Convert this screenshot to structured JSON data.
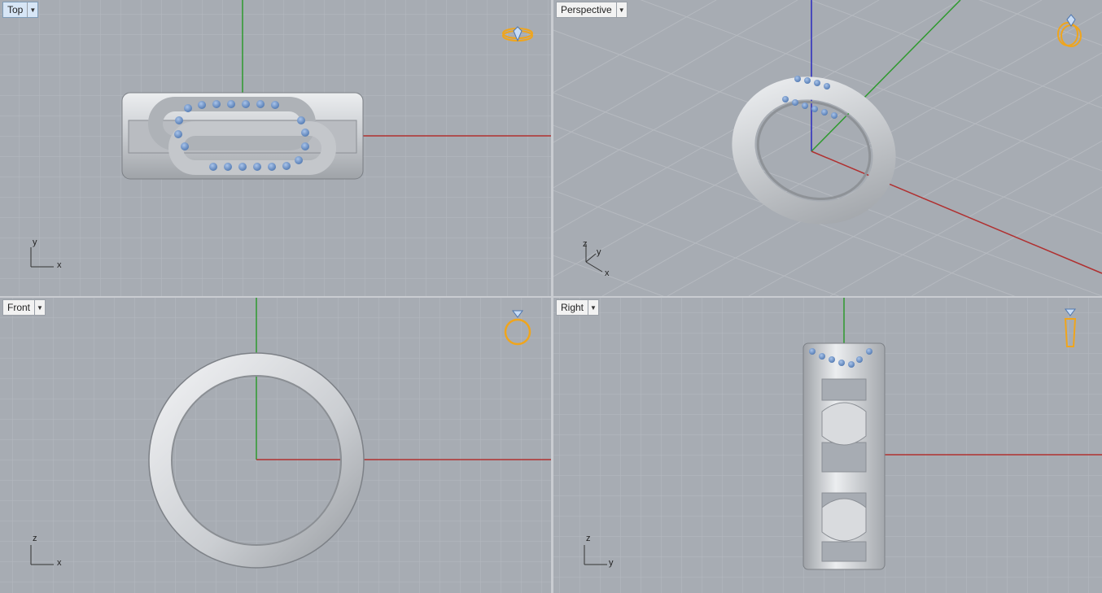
{
  "viewports": {
    "top": {
      "label": "Top",
      "active": true,
      "axis_h": "x",
      "axis_v": "y",
      "widget_icon": "ring-top-view-icon"
    },
    "perspective": {
      "label": "Perspective",
      "active": false,
      "axis_h": "x",
      "axis_v": "y",
      "axis_z": "z",
      "widget_icon": "ring-perspective-icon"
    },
    "front": {
      "label": "Front",
      "active": false,
      "axis_h": "x",
      "axis_v": "z",
      "widget_icon": "ring-front-view-icon"
    },
    "right": {
      "label": "Right",
      "active": false,
      "axis_h": "y",
      "axis_v": "z",
      "widget_icon": "ring-side-view-icon"
    }
  },
  "colors": {
    "viewport_bg": "#a7acb3",
    "grid_minor": "#b4b8be",
    "grid_major": "#8e939a",
    "axis_x": "#b03030",
    "axis_y": "#2e9a2e",
    "axis_z": "#2a2ac0",
    "metal": "#d4d6d9",
    "gem": "#6a93c8",
    "widget": "#f0a51c"
  }
}
